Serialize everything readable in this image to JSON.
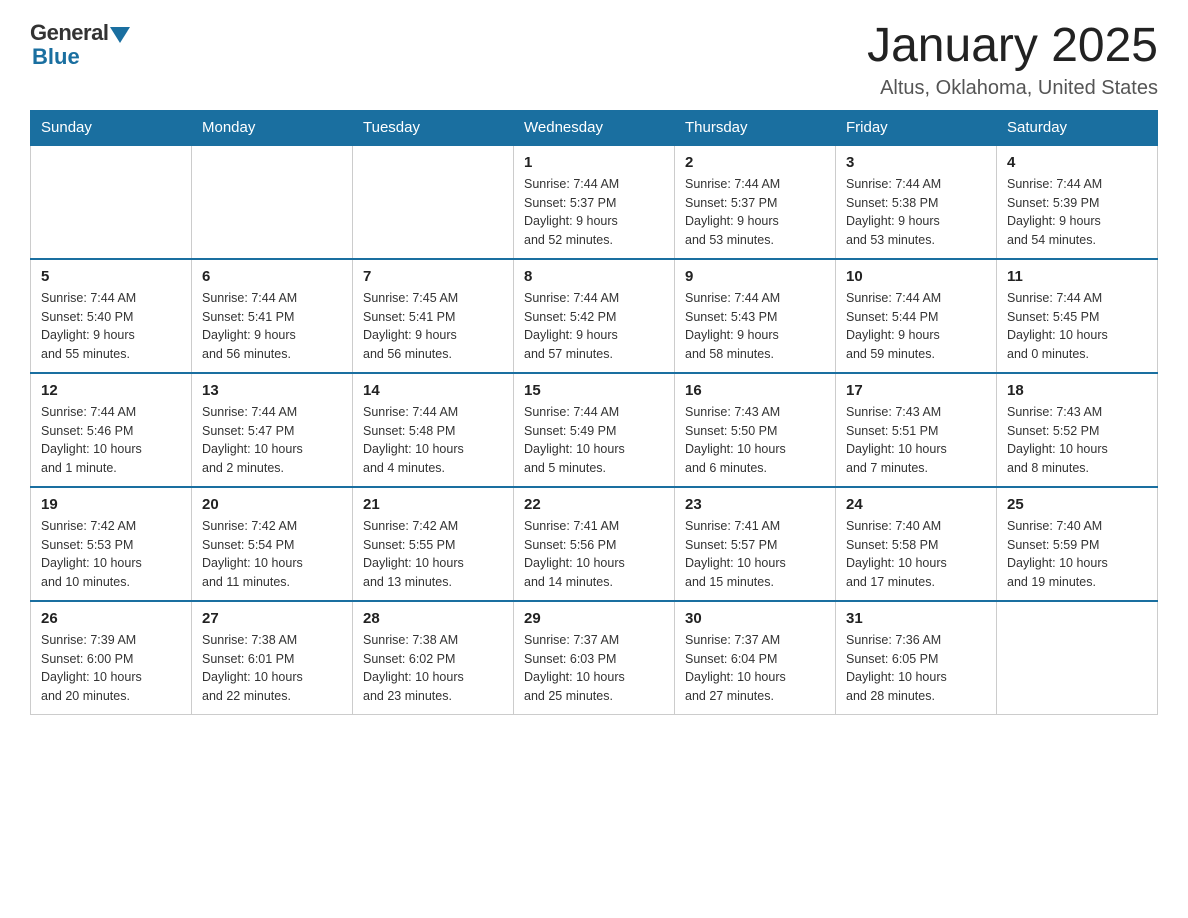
{
  "logo": {
    "general": "General",
    "blue": "Blue"
  },
  "header": {
    "title": "January 2025",
    "subtitle": "Altus, Oklahoma, United States"
  },
  "weekdays": [
    "Sunday",
    "Monday",
    "Tuesday",
    "Wednesday",
    "Thursday",
    "Friday",
    "Saturday"
  ],
  "weeks": [
    [
      {
        "day": "",
        "info": ""
      },
      {
        "day": "",
        "info": ""
      },
      {
        "day": "",
        "info": ""
      },
      {
        "day": "1",
        "info": "Sunrise: 7:44 AM\nSunset: 5:37 PM\nDaylight: 9 hours\nand 52 minutes."
      },
      {
        "day": "2",
        "info": "Sunrise: 7:44 AM\nSunset: 5:37 PM\nDaylight: 9 hours\nand 53 minutes."
      },
      {
        "day": "3",
        "info": "Sunrise: 7:44 AM\nSunset: 5:38 PM\nDaylight: 9 hours\nand 53 minutes."
      },
      {
        "day": "4",
        "info": "Sunrise: 7:44 AM\nSunset: 5:39 PM\nDaylight: 9 hours\nand 54 minutes."
      }
    ],
    [
      {
        "day": "5",
        "info": "Sunrise: 7:44 AM\nSunset: 5:40 PM\nDaylight: 9 hours\nand 55 minutes."
      },
      {
        "day": "6",
        "info": "Sunrise: 7:44 AM\nSunset: 5:41 PM\nDaylight: 9 hours\nand 56 minutes."
      },
      {
        "day": "7",
        "info": "Sunrise: 7:45 AM\nSunset: 5:41 PM\nDaylight: 9 hours\nand 56 minutes."
      },
      {
        "day": "8",
        "info": "Sunrise: 7:44 AM\nSunset: 5:42 PM\nDaylight: 9 hours\nand 57 minutes."
      },
      {
        "day": "9",
        "info": "Sunrise: 7:44 AM\nSunset: 5:43 PM\nDaylight: 9 hours\nand 58 minutes."
      },
      {
        "day": "10",
        "info": "Sunrise: 7:44 AM\nSunset: 5:44 PM\nDaylight: 9 hours\nand 59 minutes."
      },
      {
        "day": "11",
        "info": "Sunrise: 7:44 AM\nSunset: 5:45 PM\nDaylight: 10 hours\nand 0 minutes."
      }
    ],
    [
      {
        "day": "12",
        "info": "Sunrise: 7:44 AM\nSunset: 5:46 PM\nDaylight: 10 hours\nand 1 minute."
      },
      {
        "day": "13",
        "info": "Sunrise: 7:44 AM\nSunset: 5:47 PM\nDaylight: 10 hours\nand 2 minutes."
      },
      {
        "day": "14",
        "info": "Sunrise: 7:44 AM\nSunset: 5:48 PM\nDaylight: 10 hours\nand 4 minutes."
      },
      {
        "day": "15",
        "info": "Sunrise: 7:44 AM\nSunset: 5:49 PM\nDaylight: 10 hours\nand 5 minutes."
      },
      {
        "day": "16",
        "info": "Sunrise: 7:43 AM\nSunset: 5:50 PM\nDaylight: 10 hours\nand 6 minutes."
      },
      {
        "day": "17",
        "info": "Sunrise: 7:43 AM\nSunset: 5:51 PM\nDaylight: 10 hours\nand 7 minutes."
      },
      {
        "day": "18",
        "info": "Sunrise: 7:43 AM\nSunset: 5:52 PM\nDaylight: 10 hours\nand 8 minutes."
      }
    ],
    [
      {
        "day": "19",
        "info": "Sunrise: 7:42 AM\nSunset: 5:53 PM\nDaylight: 10 hours\nand 10 minutes."
      },
      {
        "day": "20",
        "info": "Sunrise: 7:42 AM\nSunset: 5:54 PM\nDaylight: 10 hours\nand 11 minutes."
      },
      {
        "day": "21",
        "info": "Sunrise: 7:42 AM\nSunset: 5:55 PM\nDaylight: 10 hours\nand 13 minutes."
      },
      {
        "day": "22",
        "info": "Sunrise: 7:41 AM\nSunset: 5:56 PM\nDaylight: 10 hours\nand 14 minutes."
      },
      {
        "day": "23",
        "info": "Sunrise: 7:41 AM\nSunset: 5:57 PM\nDaylight: 10 hours\nand 15 minutes."
      },
      {
        "day": "24",
        "info": "Sunrise: 7:40 AM\nSunset: 5:58 PM\nDaylight: 10 hours\nand 17 minutes."
      },
      {
        "day": "25",
        "info": "Sunrise: 7:40 AM\nSunset: 5:59 PM\nDaylight: 10 hours\nand 19 minutes."
      }
    ],
    [
      {
        "day": "26",
        "info": "Sunrise: 7:39 AM\nSunset: 6:00 PM\nDaylight: 10 hours\nand 20 minutes."
      },
      {
        "day": "27",
        "info": "Sunrise: 7:38 AM\nSunset: 6:01 PM\nDaylight: 10 hours\nand 22 minutes."
      },
      {
        "day": "28",
        "info": "Sunrise: 7:38 AM\nSunset: 6:02 PM\nDaylight: 10 hours\nand 23 minutes."
      },
      {
        "day": "29",
        "info": "Sunrise: 7:37 AM\nSunset: 6:03 PM\nDaylight: 10 hours\nand 25 minutes."
      },
      {
        "day": "30",
        "info": "Sunrise: 7:37 AM\nSunset: 6:04 PM\nDaylight: 10 hours\nand 27 minutes."
      },
      {
        "day": "31",
        "info": "Sunrise: 7:36 AM\nSunset: 6:05 PM\nDaylight: 10 hours\nand 28 minutes."
      },
      {
        "day": "",
        "info": ""
      }
    ]
  ]
}
